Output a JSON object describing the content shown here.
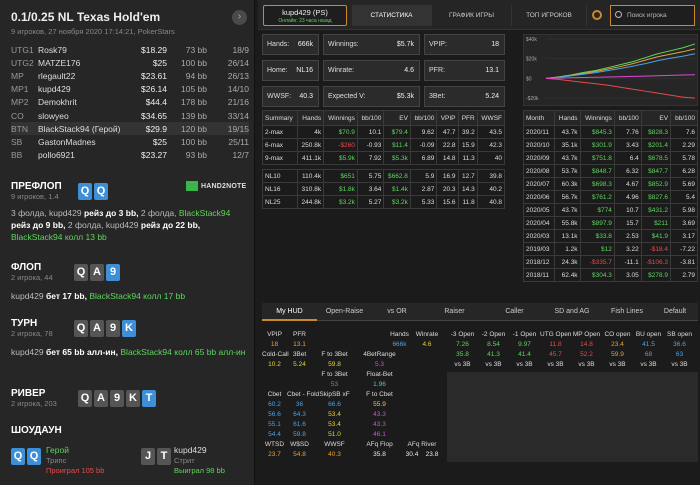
{
  "hand": {
    "title": "0.1/0.25 NL Texas Hold'em",
    "subtitle": "9 игроков, 27 ноября 2020 17:14:21, PokerStars",
    "next_icon": "chevron-right-icon"
  },
  "players": [
    {
      "pos": "UTG1",
      "name": "Rosk79",
      "stack": "$18.29",
      "bb": "73 bb",
      "seat": "18/9",
      "highlight": false
    },
    {
      "pos": "UTG2",
      "name": "MATZE176",
      "stack": "$25",
      "bb": "100 bb",
      "seat": "26/14",
      "highlight": false
    },
    {
      "pos": "MP",
      "name": "rlegault22",
      "stack": "$23.61",
      "bb": "94 bb",
      "seat": "26/13",
      "highlight": false
    },
    {
      "pos": "MP1",
      "name": "kupd429",
      "stack": "$26.14",
      "bb": "105 bb",
      "seat": "14/10",
      "highlight": false
    },
    {
      "pos": "MP2",
      "name": "Demokhrit",
      "stack": "$44.4",
      "bb": "178 bb",
      "seat": "21/16",
      "highlight": false
    },
    {
      "pos": "CO",
      "name": "slowyeo",
      "stack": "$34.65",
      "bb": "139 bb",
      "seat": "33/14",
      "highlight": false
    },
    {
      "pos": "BTN",
      "name": "BlackStack94 (Герой)",
      "stack": "$29.9",
      "bb": "120 bb",
      "seat": "19/15",
      "highlight": true
    },
    {
      "pos": "SB",
      "name": "GastonMadnes",
      "stack": "$25",
      "bb": "100 bb",
      "seat": "25/11",
      "highlight": false
    },
    {
      "pos": "BB",
      "name": "pollo6921",
      "stack": "$23.27",
      "bb": "93 bb",
      "seat": "12/7",
      "highlight": false
    }
  ],
  "preflop": {
    "label": "ПРЕФЛОП",
    "sub": "9 игроков, 1.4",
    "cards": [
      "Q",
      "Q"
    ],
    "brand": "HAND2NOTE",
    "a1": "3 фолда, ",
    "a2": "kupd429",
    "a3": " рейз до 3 bb, ",
    "a4": "2 фолда, ",
    "a5": "BlackStack94",
    "a6": " рейз до 9 bb, ",
    "a7": "2 фолда, ",
    "a8": "kupd429",
    "a9": " рейз до 22 bb, ",
    "a10": "BlackStack94",
    "a11": " колл 13 bb"
  },
  "flop": {
    "label": "ФЛОП",
    "sub": "2 игрока, 44",
    "cards": [
      "Q",
      "A",
      "9"
    ],
    "a1": "kupd429",
    "a2": " бет 17 bb, ",
    "a3": "BlackStack94",
    "a4": " колл 17 bb"
  },
  "turn": {
    "label": "ТУРН",
    "sub": "2 игрока, 78",
    "cards": [
      "Q",
      "A",
      "9",
      "K"
    ],
    "a1": "kupd429",
    "a2": " бет 65 bb алл-ин, ",
    "a3": "BlackStack94",
    "a4": " колл 65 bb алл-ин"
  },
  "river": {
    "label": "РИВЕР",
    "sub": "2 игрока, 203",
    "cards": [
      "Q",
      "A",
      "9",
      "K",
      "T"
    ]
  },
  "showdown": {
    "label": "ШОУДАУН",
    "hero": {
      "cards": [
        "Q",
        "Q"
      ],
      "name": "Герой",
      "hand": "Трипс",
      "result": "Проиграл 105 bb"
    },
    "villain": {
      "cards": [
        "J",
        "T"
      ],
      "name": "kupd429",
      "hand": "Стрит",
      "result": "Выиграл 98 bb"
    }
  },
  "top": {
    "player": "kupd429 (PS)",
    "online": "Онлайн: 23 часа назад",
    "tabs": [
      "СТАТИСТИКА",
      "ГРАФИК ИГРЫ",
      "ТОП ИГРОКОВ"
    ],
    "search_placeholder": "Поиск игрока"
  },
  "summary_boxes": [
    {
      "label": "Hands:",
      "value": "666k",
      "green": false
    },
    {
      "label": "Winnings:",
      "value": "$5.7k",
      "green": true
    },
    {
      "label": "VPIP:",
      "value": "18",
      "green": false
    },
    {
      "label": "Home:",
      "value": "NL16",
      "green": false
    },
    {
      "label": "Winrate:",
      "value": "4.6",
      "green": true
    },
    {
      "label": "PFR:",
      "value": "13.1",
      "green": false
    },
    {
      "label": "WWSF:",
      "value": "40.3",
      "green": false
    },
    {
      "label": "Expected V:",
      "value": "$5.3k",
      "green": true
    },
    {
      "label": "3Bet:",
      "value": "5.24",
      "green": false
    }
  ],
  "summary_table": {
    "headers": [
      "Summary",
      "Hands",
      "Winnings",
      "bb/100",
      "EV",
      "bb/100",
      "VPIP",
      "PFR",
      "WWSF"
    ],
    "rows": [
      [
        "2-max",
        "4k",
        "$70.9",
        "10.1",
        "$79.4",
        "9.62",
        "47.7",
        "39.2",
        "43.5"
      ],
      [
        "6-max",
        "250.8k",
        "-$260",
        "-0.93",
        "$11.4",
        "-0.09",
        "22.8",
        "15.9",
        "42.3"
      ],
      [
        "9-max",
        "411.1k",
        "$5.9k",
        "7.92",
        "$5.3k",
        "6.89",
        "14.8",
        "11.3",
        "40"
      ],
      [
        "NL10",
        "110.4k",
        "$651",
        "5.75",
        "$662.8",
        "5.9",
        "16.9",
        "12.7",
        "39.8"
      ],
      [
        "NL16",
        "310.8k",
        "$1.8k",
        "3.64",
        "$1.4k",
        "2.87",
        "20.3",
        "14.3",
        "40.2"
      ],
      [
        "NL25",
        "244.8k",
        "$3.2k",
        "5.27",
        "$3.2k",
        "5.33",
        "15.6",
        "11.8",
        "40.8"
      ]
    ]
  },
  "monthly_table": {
    "headers": [
      "Month",
      "Hands",
      "Winnings",
      "bb/100",
      "EV",
      "bb/100"
    ],
    "rows": [
      [
        "2020/11",
        "43.7k",
        "$845.3",
        "7.76",
        "$828.3",
        "7.6"
      ],
      [
        "2020/10",
        "35.1k",
        "$301.9",
        "3.43",
        "$201.4",
        "2.29"
      ],
      [
        "2020/09",
        "43.7k",
        "$751.8",
        "6.4",
        "$678.5",
        "5.78"
      ],
      [
        "2020/08",
        "53.7k",
        "$848.7",
        "6.32",
        "$847.7",
        "6.28"
      ],
      [
        "2020/07",
        "60.3k",
        "$698.3",
        "4.67",
        "$852.9",
        "5.69"
      ],
      [
        "2020/06",
        "56.7k",
        "$761.2",
        "4.96",
        "$827.6",
        "5.4"
      ],
      [
        "2020/05",
        "43.7k",
        "$774",
        "10.7",
        "$431.2",
        "5.98"
      ],
      [
        "2020/04",
        "55.8k",
        "$897.9",
        "15.7",
        "$211",
        "3.69"
      ],
      [
        "2020/03",
        "13.1k",
        "$33.8",
        "2.53",
        "$41.9",
        "3.17"
      ],
      [
        "2019/03",
        "1.2k",
        "$12",
        "3.22",
        "-$18.4",
        "-7.22"
      ],
      [
        "2018/12",
        "24.3k",
        "-$335.7",
        "-11.1",
        "-$106.3",
        "-3.81"
      ],
      [
        "2018/11",
        "62.4k",
        "$304.3",
        "3.05",
        "$278.9",
        "2.79"
      ]
    ]
  },
  "chart_data": {
    "type": "line",
    "yticks": [
      "$40k",
      "$20k",
      "$0",
      "-$20k"
    ],
    "ylim": [
      -25000,
      40000
    ],
    "series": [
      {
        "values": [
          0,
          1500,
          3500,
          6000,
          8000,
          11000,
          14000,
          17000,
          21000,
          25000,
          28000,
          31000,
          35000
        ],
        "color": "#5cd65c"
      },
      {
        "values": [
          0,
          1200,
          2900,
          5000,
          7000,
          9500,
          12000,
          15000,
          18500,
          22000,
          24500,
          27000,
          30000
        ],
        "color": "#e5a43a"
      },
      {
        "values": [
          0,
          1000,
          2500,
          4200,
          5800,
          8000,
          10000,
          12500,
          15000,
          18000,
          20500,
          22500,
          25000
        ],
        "color": "#4aa3e8"
      },
      {
        "values": [
          0,
          -1000,
          -2500,
          -4000,
          -5500,
          -7000,
          -9000,
          -11000,
          -13000,
          -15000,
          -17000,
          -19000,
          -20000
        ],
        "color": "#e84a4a"
      },
      {
        "values": [
          0,
          300,
          600,
          900,
          1100,
          1400,
          1700,
          2000,
          2300,
          2700,
          3000,
          3400,
          3700
        ],
        "color": "#d94ad9"
      }
    ]
  },
  "hud_tabs": [
    "My HUD",
    "Open-Raise",
    "vs OR",
    "Raiser",
    "Caller",
    "SD and AG",
    "Fish Lines",
    "Default"
  ],
  "hud": {
    "r1": {
      "vpip_l": "VPIP",
      "pfr_l": "PFR",
      "vpip": "18",
      "pfr": "13.1",
      "hands_l": "Hands",
      "winrate_l": "Winrate",
      "hands": "666k",
      "winrate": "4.6"
    },
    "r2": {
      "cold_l": "Cold-Call",
      "b3_l": "3Bet",
      "f3_l": "F to 3Bet",
      "b4_l": "4BetRange",
      "cold": "10.2",
      "b3": "5.24",
      "f3": "59.8",
      "b4": "5.3"
    },
    "r3": {
      "f3b_l": "F to 3Bet",
      "fb_l": "Float-Bet",
      "f3b": "53",
      "fb": "1.96"
    },
    "r4": {
      "cb_l": "Cbet",
      "cbf_l": "Cbet - Fold",
      "sk_l": "SkipSB xF",
      "ft_l": "F to Cbet",
      "cb": "60.2",
      "cbf": "36",
      "sk": "66.6",
      "ft": "55.9"
    },
    "r5": {
      "a": "56.6",
      "b": "64.3",
      "c": "53.4",
      "d": "43.3"
    },
    "r6": {
      "a": "55.1",
      "b": "61.6",
      "c": "53.4",
      "d": "43.3"
    },
    "r7": {
      "a": "54.4",
      "b": "59.8",
      "c": "51.0",
      "d": "46.1"
    },
    "r8": {
      "wtsd_l": "WTSD",
      "wsd_l": "W$SD",
      "wwsf_l": "WWSF",
      "af_l": "AFq Flop",
      "ar_l": "AFq River",
      "wtsd": "23.7",
      "wsd": "54.8",
      "wwsf": "40.3",
      "af": "35.8",
      "ar": "30.4",
      "ar2": "23.8"
    },
    "open": {
      "headers": [
        "-3 Open",
        "-2 Open",
        "-1 Open",
        "UTG Open",
        "MP Open",
        "CO open",
        "BU open",
        "SB open"
      ],
      "values": [
        "7.26",
        "8.54",
        "9.97",
        "11.8",
        "14.8",
        "23.4",
        "41.5",
        "36.6"
      ],
      "vs3b": [
        "35.8",
        "41.3",
        "41.4",
        "45.7",
        "52.2",
        "59.9",
        "68",
        "63"
      ],
      "vs3b_l": "vs 3B"
    }
  }
}
